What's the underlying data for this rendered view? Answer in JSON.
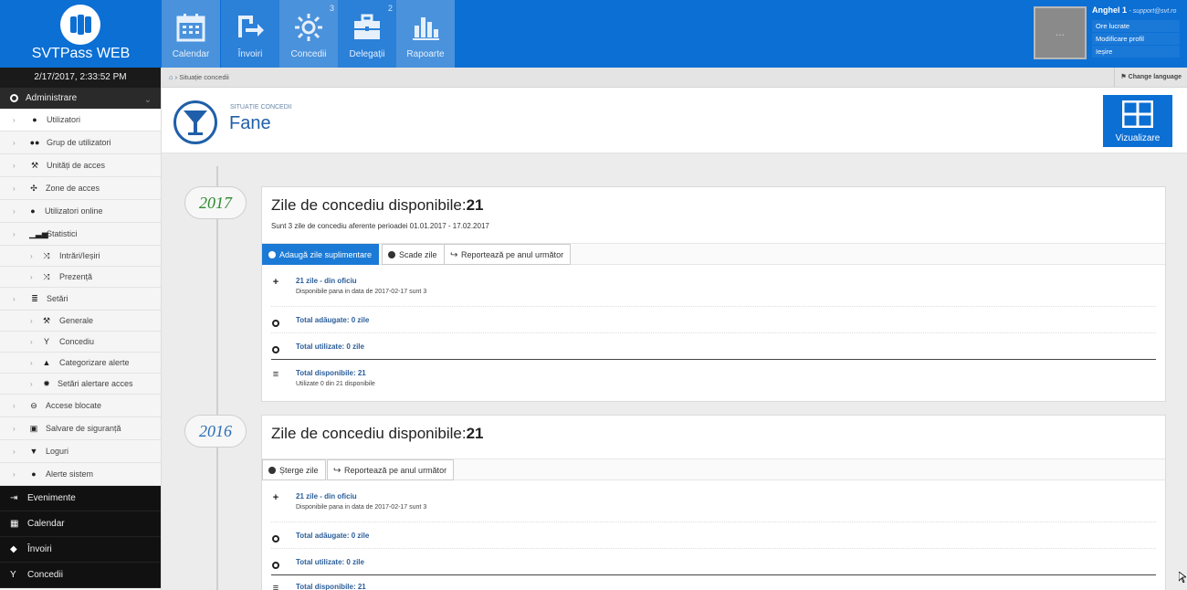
{
  "brand": {
    "name": "SVTPass WEB"
  },
  "nav": [
    {
      "label": "Calendar",
      "count": ""
    },
    {
      "label": "Învoiri",
      "count": ""
    },
    {
      "label": "Concedii",
      "count": "3"
    },
    {
      "label": "Delegații",
      "count": "2"
    },
    {
      "label": "Rapoarte",
      "count": ""
    }
  ],
  "user": {
    "name": "Anghel 1",
    "email": "- support@svt.ro",
    "avatar_text": "...",
    "menu": [
      "Ore lucrate",
      "Modificare profil",
      "Ieșire"
    ]
  },
  "sidebar": {
    "datetime": "2/17/2017, 2:33:52 PM",
    "section": "Administrare",
    "items": [
      {
        "label": "Utilizatori",
        "icon": "user-icon"
      },
      {
        "label": "Grup de utilizatori",
        "icon": "users-icon"
      },
      {
        "label": "Unități de acces",
        "icon": "wrench-icon"
      },
      {
        "label": "Zone de acces",
        "icon": "crosshair-icon"
      },
      {
        "label": "Utilizatori online",
        "icon": "user-icon"
      },
      {
        "label": "Statistici",
        "icon": "signal-icon"
      },
      {
        "label": "Intrări/Ieșiri",
        "icon": "shuffle-icon"
      },
      {
        "label": "Prezență",
        "icon": "shuffle-icon"
      },
      {
        "label": "Setări",
        "icon": "list-icon"
      },
      {
        "label": "Generale",
        "icon": "wrench-icon"
      },
      {
        "label": "Concediu",
        "icon": "glass-icon"
      },
      {
        "label": "Categorizare alerte",
        "icon": "warning-icon"
      },
      {
        "label": "Setări alertare acces",
        "icon": "gear-icon"
      },
      {
        "label": "Accese blocate",
        "icon": "minus-circle-icon"
      },
      {
        "label": "Salvare de siguranță",
        "icon": "save-icon"
      },
      {
        "label": "Loguri",
        "icon": "filter-icon"
      },
      {
        "label": "Alerte sistem",
        "icon": "info-icon"
      }
    ],
    "dark_items": [
      {
        "label": "Evenimente",
        "icon": "login-icon"
      },
      {
        "label": "Calendar",
        "icon": "calendar-icon"
      },
      {
        "label": "Învoiri",
        "icon": "tag-icon"
      },
      {
        "label": "Concedii",
        "icon": "glass-icon"
      }
    ]
  },
  "breadcrumb": {
    "current": "Situație concedii",
    "language": "Change language"
  },
  "page": {
    "subtitle": "SITUAȚIE CONCEDII",
    "title": "Fane",
    "view_button": "Vizualizare"
  },
  "years": [
    {
      "year": "2017",
      "heading": "Zile de concediu disponibile:",
      "available": "21",
      "note": "Sunt 3 zile de concediu aferente perioadei 01.01.2017 - 17.02.2017",
      "buttons": [
        "Adaugă zile suplimentare",
        "Scade zile",
        "Reportează pe anul următor"
      ],
      "rows": [
        {
          "title": "21 zile - din oficiu",
          "sub": "Disponibile pana in data de 2017-02-17 sunt 3"
        },
        {
          "title": "Total adăugate: 0 zile",
          "sub": ""
        },
        {
          "title": "Total utilizate: 0 zile",
          "sub": ""
        },
        {
          "title": "Total disponibile: 21",
          "sub": "Utilizate 0 din 21 disponibile"
        }
      ]
    },
    {
      "year": "2016",
      "heading": "Zile de concediu disponibile:",
      "available": "21",
      "note": "",
      "buttons": [
        "Șterge zile",
        "Reportează pe anul următor"
      ],
      "rows": [
        {
          "title": "21 zile - din oficiu",
          "sub": "Disponibile pana in data de 2017-02-17 sunt 3"
        },
        {
          "title": "Total adăugate: 0 zile",
          "sub": ""
        },
        {
          "title": "Total utilizate: 0 zile",
          "sub": ""
        },
        {
          "title": "Total disponibile: 21",
          "sub": ""
        }
      ]
    }
  ]
}
